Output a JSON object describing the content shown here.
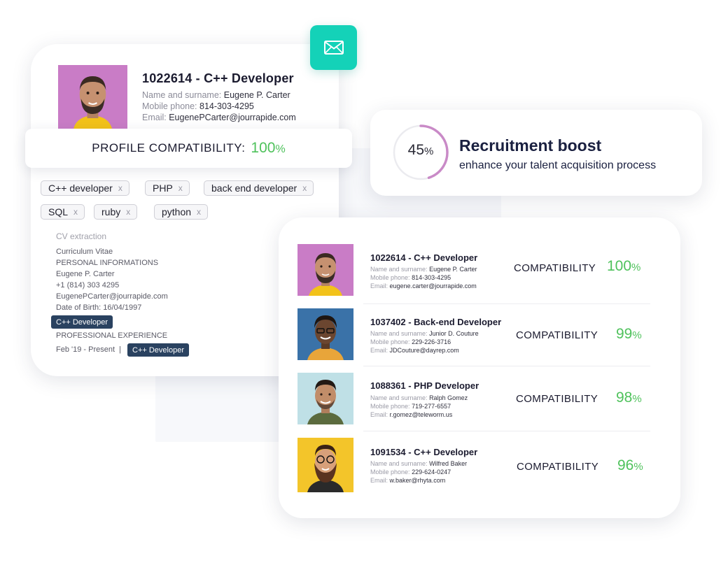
{
  "profile": {
    "title": "1022614 - C++ Developer",
    "name_label": "Name and surname:",
    "name": "Eugene P. Carter",
    "phone_label": "Mobile phone:",
    "phone": "814-303-4295",
    "email_label": "Email:",
    "email": "EugenePCarter@jourrapide.com",
    "compat_label": "PROFILE COMPATIBILITY:",
    "compat_value": "100",
    "pct": "%"
  },
  "skills": [
    "C++ developer",
    "PHP",
    "back end developer",
    "SQL",
    "ruby",
    "python"
  ],
  "skill_remove": "x",
  "cv": {
    "header": "CV extraction",
    "lines": [
      "Curriculum Vitae",
      "PERSONAL INFORMATIONS",
      "Eugene P. Carter",
      "+1 (814) 303 4295",
      "EugenePCarter@jourrapide.com",
      "Date of Birth: 16/04/1997"
    ],
    "chip": "C++ Developer",
    "experience": "PROFESSIONAL EXPERIENCE",
    "period": "Feb '19 - Present  |",
    "chip2": "C++ Developer"
  },
  "boost": {
    "value": "45",
    "percent": 45,
    "pct": "%",
    "title": "Recruitment boost",
    "subtitle": "enhance your talent acquisition process"
  },
  "candidates": [
    {
      "title": "1022614 - C++ Developer",
      "name": "Eugene P. Carter",
      "phone": "814-303-4295",
      "email": "eugene.carter@jourrapide.com",
      "compat": "100"
    },
    {
      "title": "1037402 - Back-end Developer",
      "name": "Junior D. Couture",
      "phone": "229-226-3716",
      "email": "JDCouture@dayrep.com",
      "compat": "99"
    },
    {
      "title": "1088361 - PHP Developer",
      "name": "Ralph Gomez",
      "phone": "719-277-6557",
      "email": "r.gomez@teleworm.us",
      "compat": "98"
    },
    {
      "title": "1091534 - C++ Developer",
      "name": "Wilfred Baker",
      "phone": "229-624-0247",
      "email": "w.baker@rhyta.com",
      "compat": "96"
    }
  ],
  "labels": {
    "name": "Name and surname:",
    "phone": "Mobile phone:",
    "email": "Email:",
    "compatibility": "COMPATIBILITY",
    "pct": "%"
  },
  "colors": {
    "accent_teal": "#14d2b8",
    "compat_green": "#4fc25c",
    "ring_pink": "#c98ac7",
    "chip_navy": "#2a4260"
  },
  "icons": {
    "mail": "envelope-icon"
  }
}
